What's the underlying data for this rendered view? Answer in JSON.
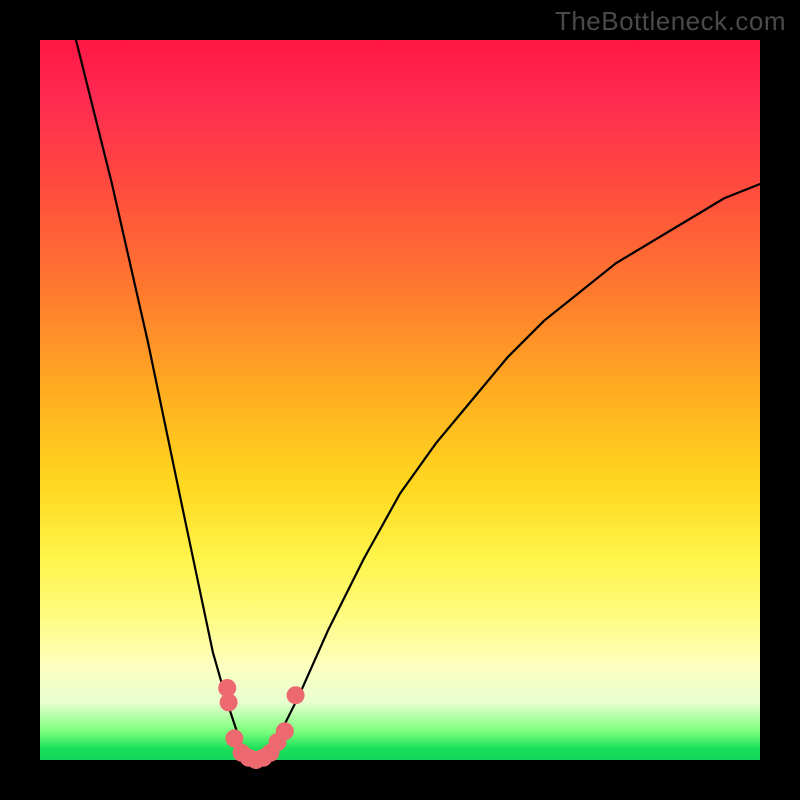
{
  "watermark": "TheBottleneck.com",
  "colors": {
    "frame": "#000000",
    "curve": "#000000",
    "marker": "#ec6a6f",
    "gradient_stops": [
      "#ff1744",
      "#ff4a3f",
      "#ffb11f",
      "#fff44a",
      "#fdffc0",
      "#18e05a"
    ]
  },
  "chart_data": {
    "type": "line",
    "title": "",
    "xlabel": "",
    "ylabel": "",
    "xlim": [
      0,
      100
    ],
    "ylim": [
      0,
      100
    ],
    "grid": false,
    "legend": false,
    "valley_x": 30,
    "series": [
      {
        "name": "bottleneck-curve",
        "x": [
          5,
          10,
          15,
          20,
          24,
          26,
          28,
          29,
          30,
          31,
          32,
          34,
          36,
          40,
          45,
          50,
          55,
          60,
          65,
          70,
          75,
          80,
          85,
          90,
          95,
          100
        ],
        "y": [
          100,
          80,
          58,
          34,
          15,
          8,
          2,
          0.5,
          0,
          0.5,
          2,
          5,
          9,
          18,
          28,
          37,
          44,
          50,
          56,
          61,
          65,
          69,
          72,
          75,
          78,
          80
        ]
      }
    ],
    "markers": [
      {
        "x": 26.0,
        "y": 10
      },
      {
        "x": 26.2,
        "y": 8
      },
      {
        "x": 27.0,
        "y": 3
      },
      {
        "x": 28.0,
        "y": 1
      },
      {
        "x": 29.0,
        "y": 0.3
      },
      {
        "x": 30.0,
        "y": 0
      },
      {
        "x": 31.0,
        "y": 0.3
      },
      {
        "x": 32.0,
        "y": 1
      },
      {
        "x": 33.0,
        "y": 2.5
      },
      {
        "x": 34.0,
        "y": 4
      },
      {
        "x": 35.5,
        "y": 9
      }
    ]
  }
}
